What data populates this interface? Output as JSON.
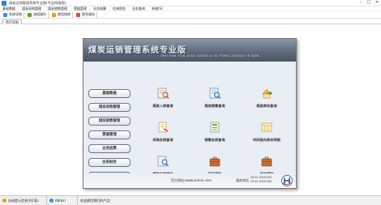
{
  "window": {
    "title": "煤炭运销管理系统专业版(专业网络版)"
  },
  "menu": [
    "基础数据",
    "煤炭采购管理",
    "煤炭销售管理",
    "票据管理",
    "业务结算",
    "往来财务",
    "业务查询",
    "系统(S)"
  ],
  "toolbar": [
    {
      "label": "系统导航",
      "icon": "navigation-icon"
    },
    {
      "label": "流程操作",
      "icon": "flow-icon"
    },
    {
      "label": "使用指南",
      "icon": "guide-icon"
    },
    {
      "label": "更多服务",
      "icon": "service-icon"
    }
  ],
  "tab": {
    "label": "首页导航"
  },
  "panel": {
    "title": "煤炭运销管理系统专业版",
    "subtitle": "MEI TAN YUN XIAO GUAN LI XI TONG ZHUAN YE BAN"
  },
  "nav": [
    "基础数据",
    "煤炭采购管理",
    "煤炭销售管理",
    "票据管理",
    "业务结算",
    "往来财务",
    "业务查询"
  ],
  "nav_active": "业务查询",
  "queries": [
    {
      "label": "煤炭入库查询",
      "icon": "coal-inbound-icon"
    },
    {
      "label": "煤炭销售查询",
      "icon": "coal-sales-icon"
    },
    {
      "label": "煤炭库存查询",
      "icon": "coal-stock-icon"
    },
    {
      "label": "采购合同查询",
      "icon": "purchase-contract-icon"
    },
    {
      "label": "销售合同查询",
      "icon": "sales-contract-icon"
    },
    {
      "label": "时间段内库存明细",
      "icon": "period-stock-icon"
    },
    {
      "label": "煤种当前库存",
      "icon": "coal-type-stock-icon"
    },
    {
      "label": "矿区煤种",
      "icon": "mine-coal-icon"
    },
    {
      "label": "单位煤种",
      "icon": "unit-coal-icon"
    }
  ],
  "footer": {
    "website": "官方网站:www.zumin.com",
    "phone_label": "服务电话",
    "phones": [
      "0635-8306095",
      "0635-8306088"
    ]
  },
  "status": {
    "item1": "自动提示信息(共1条)",
    "user": "Admin",
    "message": "欢迎使用我们的产品!"
  }
}
